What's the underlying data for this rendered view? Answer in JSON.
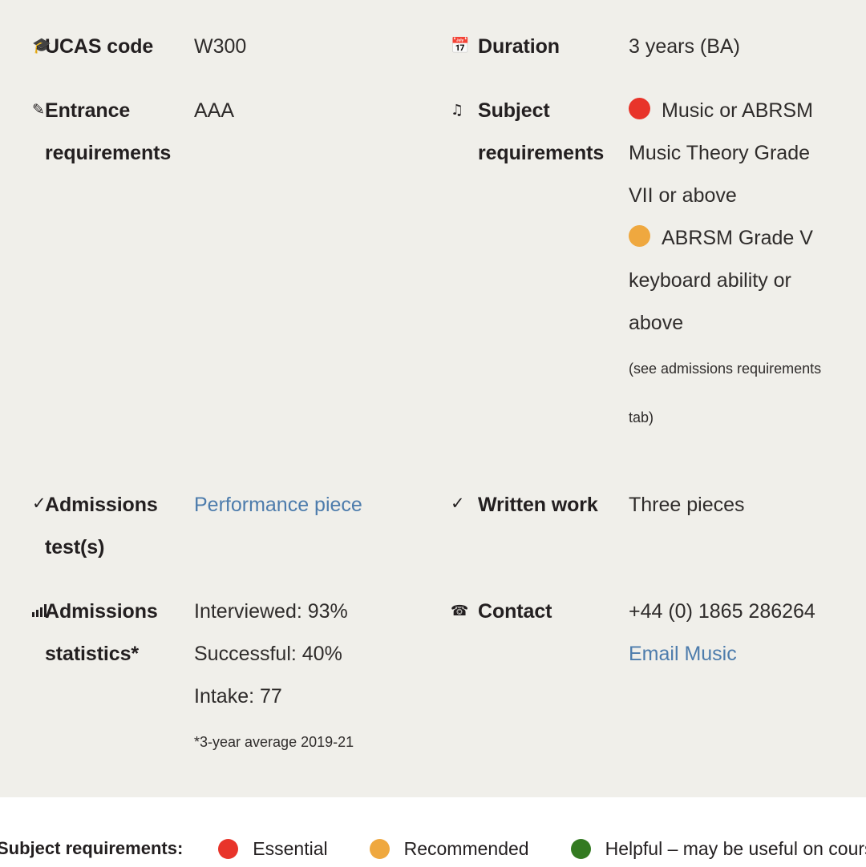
{
  "panel": {
    "background": "#f0efea",
    "accent_link": "#4d7cac"
  },
  "facts": {
    "ucas": {
      "icon": "graduation-cap-icon",
      "label": "UCAS code",
      "value": "W300"
    },
    "duration": {
      "icon": "calendar-icon",
      "label": "Duration",
      "value": "3 years (BA)"
    },
    "entrance": {
      "icon": "pencil-icon",
      "label": "Entrance requirements",
      "value": "AAA"
    },
    "subject": {
      "icon": "music-note-icon",
      "label": "Subject requirements",
      "items": [
        {
          "level": "essential",
          "color": "#e8342a",
          "text": "Music or ABRSM Music Theory Grade VII or above"
        },
        {
          "level": "recommended",
          "color": "#efa83f",
          "text": "ABRSM Grade V keyboard ability or above"
        }
      ],
      "note": "(see admissions requirements tab)"
    },
    "admissions_test": {
      "icon": "check-icon",
      "label": "Admissions test(s)",
      "value": "Performance piece",
      "is_link": true
    },
    "written_work": {
      "icon": "check-icon",
      "label": "Written work",
      "value": "Three pieces"
    },
    "admissions_statistics": {
      "icon": "bar-chart-icon",
      "label": "Admissions statistics*",
      "lines": [
        "Interviewed: 93%",
        "Successful: 40%",
        "Intake: 77"
      ],
      "footnote": "*3-year average 2019-21"
    },
    "contact": {
      "icon": "telephone-icon",
      "label": "Contact",
      "phone": "+44 (0) 1865 286264",
      "email_label": "Email Music"
    }
  },
  "legend": {
    "title": "Subject requirements:",
    "items": [
      {
        "color": "#e8342a",
        "label": "Essential"
      },
      {
        "color": "#efa83f",
        "label": "Recommended"
      },
      {
        "color": "#337a21",
        "label": "Helpful – may be useful on course"
      }
    ]
  }
}
